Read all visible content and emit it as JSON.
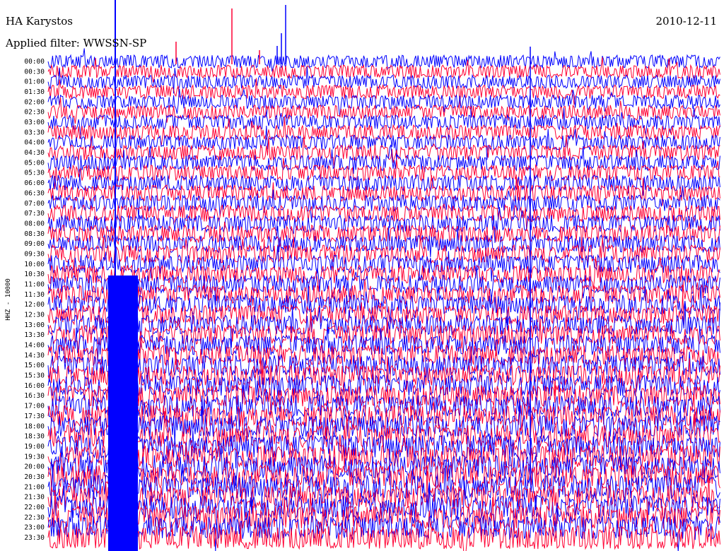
{
  "header": {
    "station": "HA Karystos",
    "filter": "Applied filter: WWSSN-SP",
    "date": "2010-12-11",
    "channel_label": "HHZ - 10000"
  },
  "colors": {
    "trace_a": "#0000ff",
    "trace_b": "#ff0033",
    "background": "#ffffff"
  },
  "chart_data": {
    "type": "line",
    "title": "HA Karystos",
    "subtitle": "Applied filter: WWSSN-SP",
    "ylabel": "HHZ - 10000",
    "row_labels": [
      "00:00",
      "00:30",
      "01:00",
      "01:30",
      "02:00",
      "02:30",
      "03:00",
      "03:30",
      "04:00",
      "04:30",
      "05:00",
      "05:30",
      "06:00",
      "06:30",
      "07:00",
      "07:30",
      "08:00",
      "08:30",
      "09:00",
      "09:30",
      "10:00",
      "10:30",
      "11:00",
      "11:30",
      "12:00",
      "12:30",
      "13:00",
      "13:30",
      "14:00",
      "14:30",
      "15:00",
      "15:30",
      "16:00",
      "16:30",
      "17:00",
      "17:30",
      "18:00",
      "18:30",
      "19:00",
      "19:30",
      "20:00",
      "20:30",
      "21:00",
      "21:30",
      "22:00",
      "22:30",
      "23:00",
      "23:30"
    ],
    "trace_colors": [
      "blue",
      "red"
    ],
    "events": [
      {
        "row": "00:00",
        "description": "tall narrow spikes near start of trace"
      },
      {
        "row": "00:00",
        "description": "local event burst about 40% across trace"
      },
      {
        "row": "10:30",
        "description": "saturated trace region near left edge continuing to end of day"
      }
    ]
  }
}
